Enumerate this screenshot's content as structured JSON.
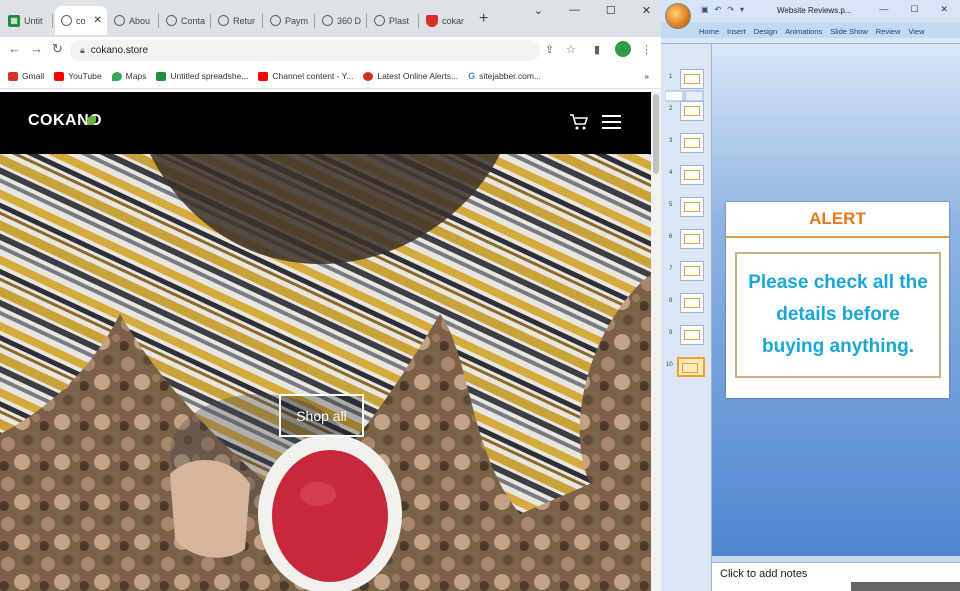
{
  "browser": {
    "tabs": [
      {
        "label": "Untit",
        "icon": "sheets-icon"
      },
      {
        "label": "co",
        "icon": "globe-icon",
        "active": true
      },
      {
        "label": "Abou",
        "icon": "globe-icon"
      },
      {
        "label": "Conta",
        "icon": "globe-icon"
      },
      {
        "label": "Retur",
        "icon": "globe-icon"
      },
      {
        "label": "Paym",
        "icon": "globe-icon"
      },
      {
        "label": "360 D",
        "icon": "globe-icon"
      },
      {
        "label": "Plast",
        "icon": "globe-icon"
      },
      {
        "label": "cokar",
        "icon": "shield-icon"
      }
    ],
    "new_tab": "+",
    "url": "cokano.store",
    "bookmarks": [
      {
        "label": "Gmail",
        "color": "#d93025"
      },
      {
        "label": "YouTube",
        "color": "#ff0000"
      },
      {
        "label": "Maps",
        "color": "#34a853"
      },
      {
        "label": "Untitled spreadshe...",
        "color": "#1e8e3e"
      },
      {
        "label": "Channel content - Y...",
        "color": "#ff0000"
      },
      {
        "label": "Latest Online Alerts...",
        "color": "#d93025"
      },
      {
        "label": "sitejabber.com...",
        "color": "#4285f4"
      }
    ]
  },
  "site": {
    "logo": "COKANO",
    "cta": "Shop all"
  },
  "powerpoint": {
    "title": "Website Reviews.p...",
    "ribbon_tabs": [
      "Home",
      "Insert",
      "Design",
      "Animations",
      "Slide Show",
      "Review",
      "View"
    ],
    "slide_numbers": [
      "1",
      "2",
      "3",
      "4",
      "5",
      "6",
      "7",
      "8",
      "9",
      "10"
    ],
    "slide": {
      "heading": "ALERT",
      "message": "Please check all the details before buying anything."
    },
    "notes_placeholder": "Click to add notes"
  },
  "colors": {
    "alert_heading": "#e07b1a",
    "alert_message": "#19a7d6",
    "site_header_bg": "#000000"
  }
}
